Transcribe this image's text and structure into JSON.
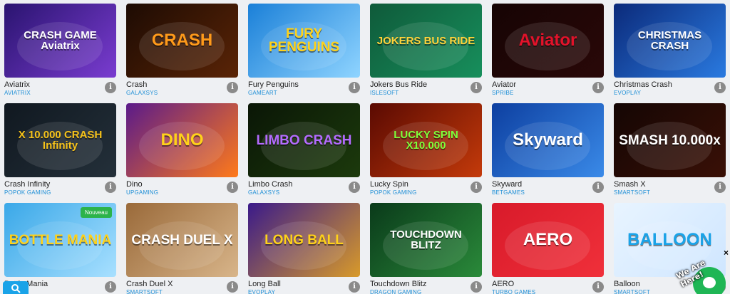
{
  "cards": [
    {
      "name": "Aviatrix",
      "provider": "AVIATRIX",
      "art": "CRASH GAME Aviatrix",
      "bg": [
        "#2a1470",
        "#7a3cd0"
      ],
      "color": "#ffffff"
    },
    {
      "name": "Crash",
      "provider": "GALAXSYS",
      "art": "CRASH",
      "bg": [
        "#1d0b03",
        "#5a2406"
      ],
      "color": "#ff9a1a"
    },
    {
      "name": "Fury Penguins",
      "provider": "GAMEART",
      "art": "FURY PENGUINS",
      "bg": [
        "#1b80d8",
        "#8fd4ff"
      ],
      "color": "#ffd21a"
    },
    {
      "name": "Jokers Bus Ride",
      "provider": "ISLESOFT",
      "art": "JOKERS BUS RIDE",
      "bg": [
        "#0f5a3a",
        "#178f5c"
      ],
      "color": "#ffd23a"
    },
    {
      "name": "Aviator",
      "provider": "SPRIBE",
      "art": "Aviator",
      "bg": [
        "#160404",
        "#2a0808"
      ],
      "color": "#e3122a"
    },
    {
      "name": "Christmas Crash",
      "provider": "EVOPLAY",
      "art": "CHRISTMAS CRASH",
      "bg": [
        "#0b2a7a",
        "#2a7ae0"
      ],
      "color": "#ffffff"
    },
    {
      "name": "Crash Infinity",
      "provider": "POPOK GAMING",
      "art": "X 10.000 CRASH Infinity",
      "bg": [
        "#101820",
        "#24303a"
      ],
      "color": "#f5c21a"
    },
    {
      "name": "Dino",
      "provider": "UPGAMING",
      "art": "DINO",
      "bg": [
        "#5a1a8a",
        "#ff7a1a"
      ],
      "color": "#ffd21a"
    },
    {
      "name": "Limbo Crash",
      "provider": "GALAXSYS",
      "art": "LIMBO CRASH",
      "bg": [
        "#0a1606",
        "#1c3a0c"
      ],
      "color": "#b46bff"
    },
    {
      "name": "Lucky Spin",
      "provider": "POPOK GAMING",
      "art": "LUCKY SPIN X10.000",
      "bg": [
        "#5a0a02",
        "#c43a0a"
      ],
      "color": "#7dff3a"
    },
    {
      "name": "Skyward",
      "provider": "BETGAMES",
      "art": "Skyward",
      "bg": [
        "#0d3fa0",
        "#3a8ae8"
      ],
      "color": "#ffffff"
    },
    {
      "name": "Smash X",
      "provider": "SMARTSOFT",
      "art": "SMASH 10.000x",
      "bg": [
        "#140604",
        "#3a1006"
      ],
      "color": "#ffffff"
    },
    {
      "name": "Bottle Mania",
      "provider": "",
      "art": "BOTTLE MANIA",
      "bg": [
        "#3aa8e8",
        "#a8e0ff"
      ],
      "color": "#ffd21a",
      "badge": "Nouveau"
    },
    {
      "name": "Crash Duel X",
      "provider": "SMARTSOFT",
      "art": "CRASH DUEL X",
      "bg": [
        "#9a6a3a",
        "#d8b58a"
      ],
      "color": "#ffffff"
    },
    {
      "name": "Long Ball",
      "provider": "EVOPLAY",
      "art": "LONG BALL",
      "bg": [
        "#3a1a8a",
        "#d89a2a"
      ],
      "color": "#ffd21a"
    },
    {
      "name": "Touchdown Blitz",
      "provider": "DRAGON GAMING",
      "art": "TOUCHDOWN BLITZ",
      "bg": [
        "#0a3a1a",
        "#2a8a3a"
      ],
      "color": "#ffffff"
    },
    {
      "name": "AERO",
      "provider": "TURBO GAMES",
      "art": "AERO",
      "bg": [
        "#d81a2a",
        "#f0303a"
      ],
      "color": "#ffffff"
    },
    {
      "name": "Balloon",
      "provider": "SMARTSOFT",
      "art": "BALLOON",
      "bg": [
        "#e8f4ff",
        "#cfe6ff"
      ],
      "color": "#1aa3e8"
    }
  ],
  "info_glyph": "i",
  "search_icon": "search-icon",
  "chat": {
    "label": "We Are Here!",
    "close": "×"
  }
}
